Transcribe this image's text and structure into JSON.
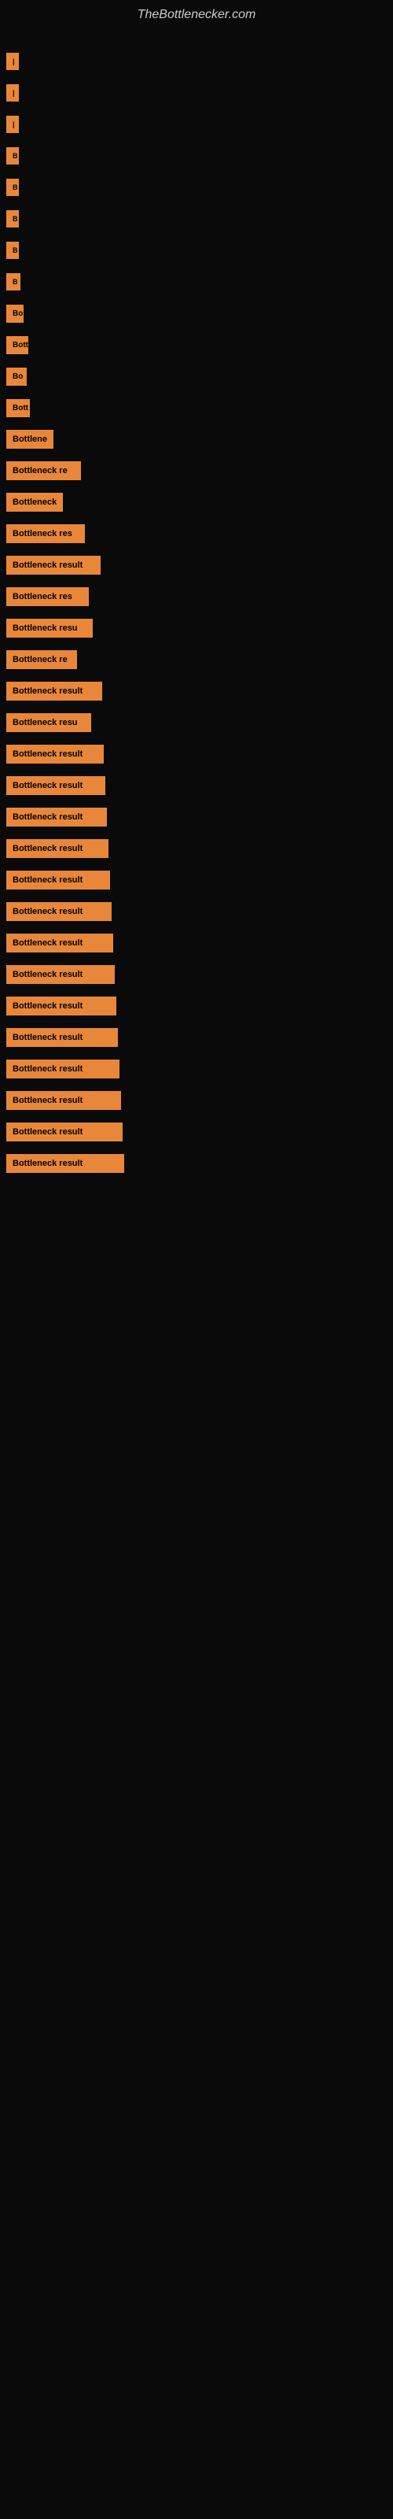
{
  "site": {
    "title": "TheBottlenecker.com"
  },
  "bars": [
    {
      "label": "|",
      "width": 4
    },
    {
      "label": "|",
      "width": 8
    },
    {
      "label": "|",
      "width": 8
    },
    {
      "label": "B",
      "width": 12
    },
    {
      "label": "B",
      "width": 12
    },
    {
      "label": "B",
      "width": 14
    },
    {
      "label": "B",
      "width": 16
    },
    {
      "label": "B",
      "width": 18
    },
    {
      "label": "Bo",
      "width": 22
    },
    {
      "label": "Bott",
      "width": 28
    },
    {
      "label": "Bo",
      "width": 26
    },
    {
      "label": "Bott",
      "width": 30
    },
    {
      "label": "Bottlene",
      "width": 60
    },
    {
      "label": "Bottleneck re",
      "width": 95
    },
    {
      "label": "Bottleneck",
      "width": 72
    },
    {
      "label": "Bottleneck res",
      "width": 100
    },
    {
      "label": "Bottleneck result",
      "width": 120
    },
    {
      "label": "Bottleneck res",
      "width": 105
    },
    {
      "label": "Bottleneck resu",
      "width": 110
    },
    {
      "label": "Bottleneck re",
      "width": 90
    },
    {
      "label": "Bottleneck result",
      "width": 122
    },
    {
      "label": "Bottleneck resu",
      "width": 108
    },
    {
      "label": "Bottleneck result",
      "width": 124
    },
    {
      "label": "Bottleneck result",
      "width": 126
    },
    {
      "label": "Bottleneck result",
      "width": 128
    },
    {
      "label": "Bottleneck result",
      "width": 130
    },
    {
      "label": "Bottleneck result",
      "width": 132
    },
    {
      "label": "Bottleneck result",
      "width": 134
    },
    {
      "label": "Bottleneck result",
      "width": 136
    },
    {
      "label": "Bottleneck result",
      "width": 138
    },
    {
      "label": "Bottleneck result",
      "width": 140
    },
    {
      "label": "Bottleneck result",
      "width": 142
    },
    {
      "label": "Bottleneck result",
      "width": 144
    },
    {
      "label": "Bottleneck result",
      "width": 146
    },
    {
      "label": "Bottleneck result",
      "width": 148
    },
    {
      "label": "Bottleneck result",
      "width": 150
    }
  ]
}
